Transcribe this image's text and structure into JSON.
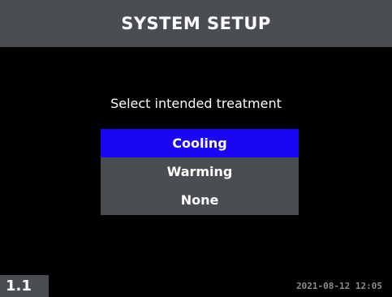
{
  "header": {
    "title": "SYSTEM SETUP"
  },
  "prompt": {
    "text": "Select intended treatment"
  },
  "menu": {
    "selected_index": 0,
    "items": [
      {
        "label": "Cooling"
      },
      {
        "label": "Warming"
      },
      {
        "label": "None"
      }
    ]
  },
  "footer": {
    "page_number": "1.1",
    "timestamp": "2021-08-12 12:05"
  },
  "colors": {
    "background": "#000000",
    "panel_gray": "#4a4d51",
    "selection_blue": "#1a06f5",
    "text_white": "#ffffff",
    "timestamp_gray": "#8a8d91"
  }
}
